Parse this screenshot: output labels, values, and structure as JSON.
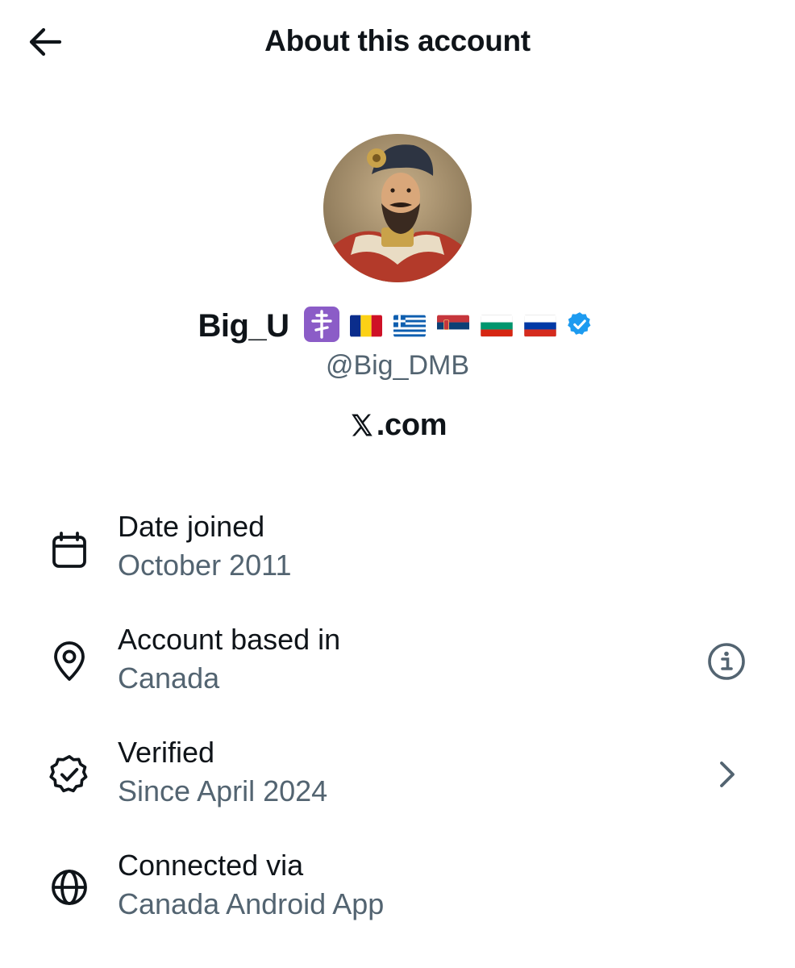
{
  "header": {
    "title": "About this account",
    "back_icon": "arrow-left-icon"
  },
  "profile": {
    "display_name": "Big_U",
    "badges": [
      "orthodox-cross-icon",
      "flag-romania",
      "flag-greece",
      "flag-serbia",
      "flag-bulgaria",
      "flag-russia",
      "verified-badge-icon"
    ],
    "handle": "@Big_DMB",
    "site": ".com",
    "verified_color": "#1d9bf0"
  },
  "details": [
    {
      "id": "date-joined",
      "icon": "calendar-icon",
      "label": "Date joined",
      "value": "October 2011",
      "trailing": null
    },
    {
      "id": "account-based-in",
      "icon": "location-pin-icon",
      "label": "Account based in",
      "value": "Canada",
      "trailing": "info-icon"
    },
    {
      "id": "verified",
      "icon": "verified-check-icon",
      "label": "Verified",
      "value": "Since April 2024",
      "trailing": "chevron-right-icon"
    },
    {
      "id": "connected-via",
      "icon": "globe-icon",
      "label": "Connected via",
      "value": "Canada Android App",
      "trailing": null
    }
  ],
  "colors": {
    "text": "#0f1419",
    "secondary": "#536471",
    "background": "#ffffff"
  }
}
